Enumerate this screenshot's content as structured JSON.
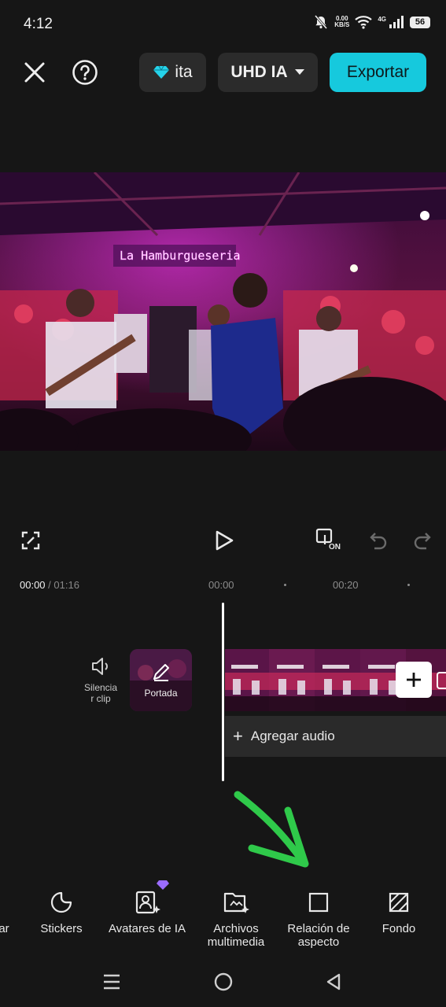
{
  "status_bar": {
    "time": "4:12",
    "net_speed_value": "0.00",
    "net_speed_unit": "KB/S",
    "network_type": "4G",
    "battery": "56"
  },
  "toolbar": {
    "close_icon": "close-icon",
    "help_icon": "help-icon",
    "pro_label": "ita",
    "resolution_label": "UHD IA",
    "export_label": "Exportar",
    "accent_color": "#16c9dd"
  },
  "preview": {
    "neon_sign": "La Hamburgueseria"
  },
  "controls": {
    "fullscreen_icon": "fullscreen-icon",
    "play_icon": "play-icon",
    "keyframe_on_label": "ON",
    "undo_icon": "undo-icon",
    "redo_icon": "redo-icon"
  },
  "timeline": {
    "current_time": "00:00",
    "total_time": "/ 01:16",
    "ruler_ticks": [
      "00:00",
      "00:20"
    ],
    "mute_label": "Silencia\nr clip",
    "cover_label": "Portada",
    "add_audio_label": "Agregar audio"
  },
  "tools": [
    {
      "label": "ar",
      "icon": "text-icon"
    },
    {
      "label": "Stickers",
      "icon": "sticker-icon"
    },
    {
      "label": "Avatares de IA",
      "icon": "ai-avatar-icon"
    },
    {
      "label": "Archivos multimedia",
      "icon": "media-add-icon"
    },
    {
      "label": "Relación de aspecto",
      "icon": "aspect-ratio-icon"
    },
    {
      "label": "Fondo",
      "icon": "background-icon"
    }
  ],
  "nav": {
    "recents_icon": "recents-icon",
    "home_icon": "home-icon",
    "back_icon": "back-icon"
  }
}
